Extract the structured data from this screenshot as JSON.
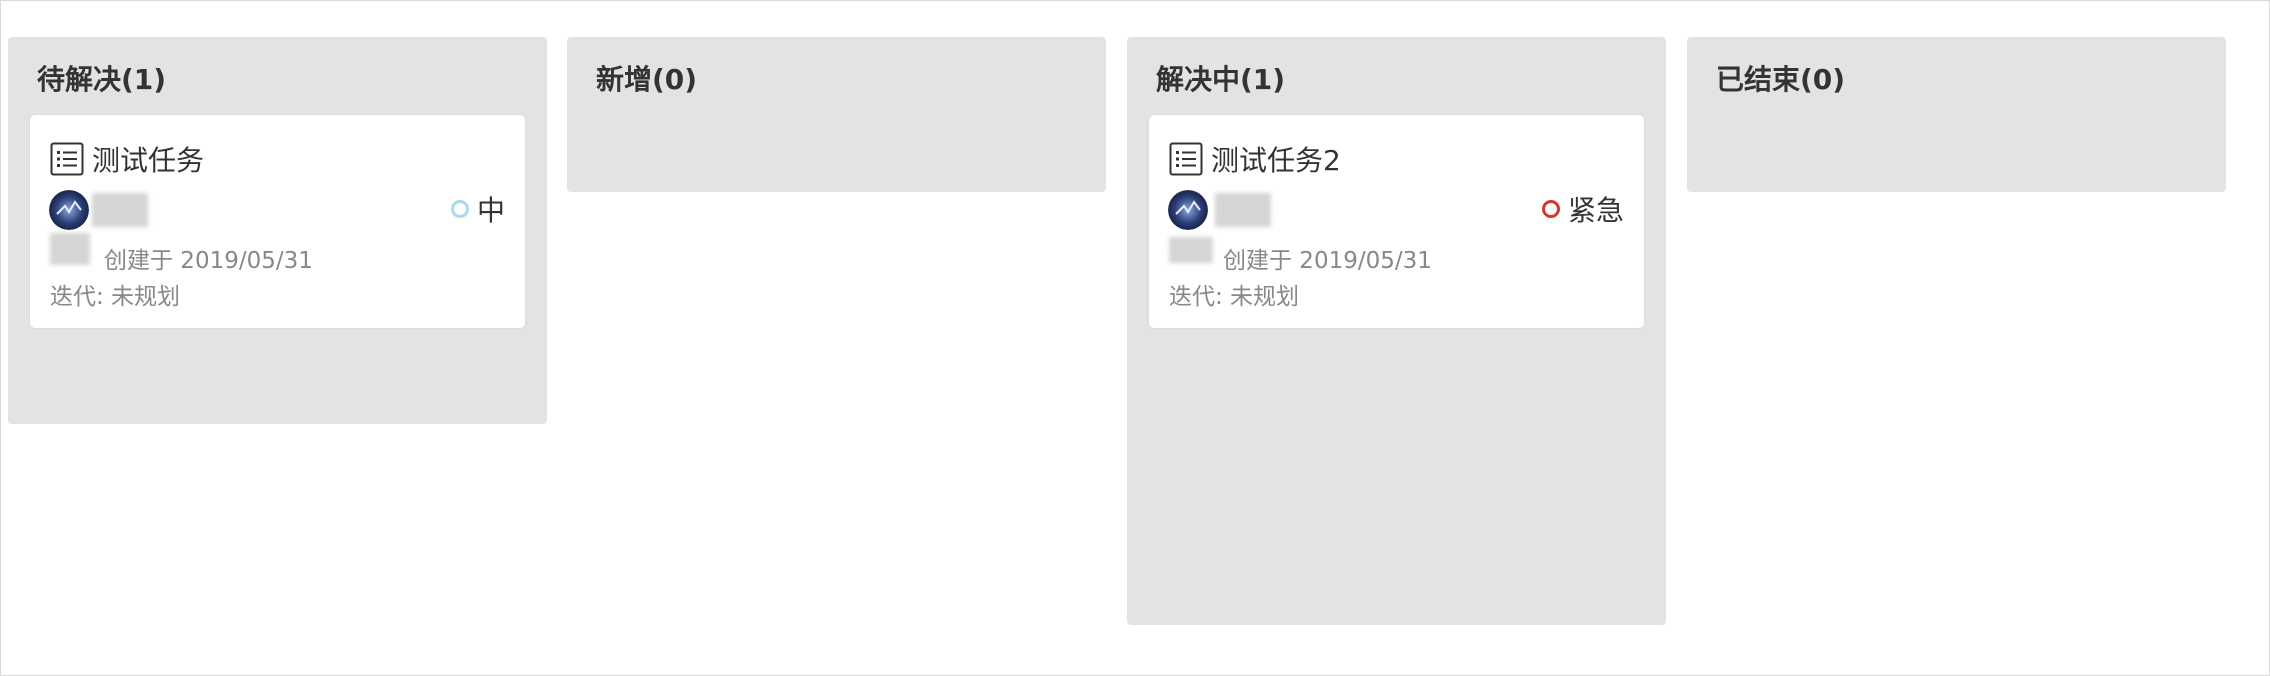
{
  "columns": [
    {
      "title": "待解决(1)",
      "cards": [
        {
          "title": "测试任务",
          "priority": "中",
          "priority_color": "#a8d8ec",
          "created": "创建于 2019/05/31",
          "iteration": "迭代: 未规划"
        }
      ]
    },
    {
      "title": "新增(0)",
      "cards": []
    },
    {
      "title": "解决中(1)",
      "cards": [
        {
          "title": "测试任务2",
          "priority": "紧急",
          "priority_color": "#d9342b",
          "created": "创建于 2019/05/31",
          "iteration": "迭代: 未规划"
        }
      ]
    },
    {
      "title": "已结束(0)",
      "cards": []
    }
  ],
  "icons": {
    "task": "task-list-icon",
    "avatar": "user-avatar"
  },
  "colors": {
    "column_bg": "#e3e3e3",
    "card_bg": "#ffffff",
    "text": "#333333",
    "muted": "#888888"
  }
}
